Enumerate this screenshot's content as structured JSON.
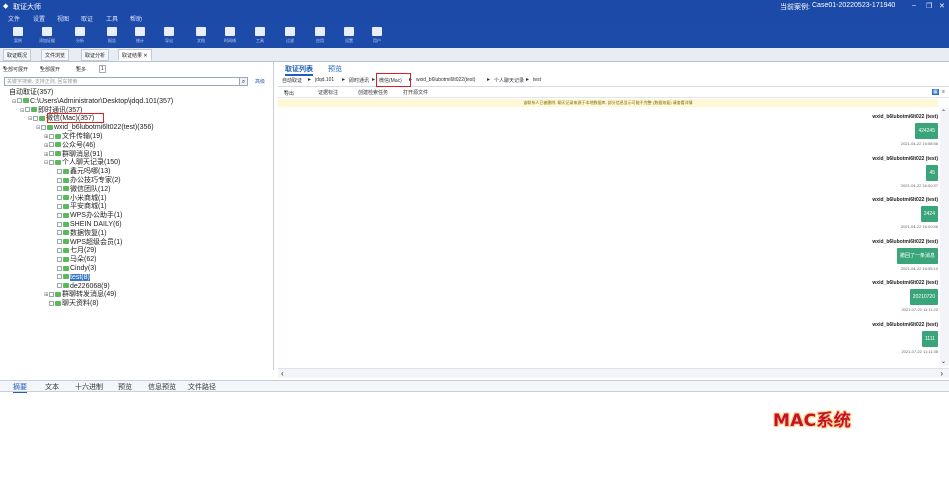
{
  "app": {
    "title": "取证大师",
    "case_label": "当前案例:",
    "case_name": "Case01-20220523-171940",
    "window_controls": [
      "–",
      "❐",
      "✕"
    ]
  },
  "menu": [
    "文件",
    "设置",
    "视图",
    "取证",
    "工具",
    "帮助"
  ],
  "toolbar": [
    {
      "icon": "case-icon",
      "label": "案例"
    },
    {
      "icon": "add-evidence-icon",
      "label": "添加证据"
    },
    {
      "icon": "analyze-icon",
      "label": "分析"
    },
    {
      "icon": "report-icon",
      "label": "报告"
    },
    {
      "icon": "stats-icon",
      "label": "统计"
    },
    {
      "icon": "export-icon",
      "label": "导出"
    },
    {
      "icon": "document-icon",
      "label": "文档"
    },
    {
      "icon": "timeline-icon",
      "label": "时间线"
    },
    {
      "icon": "tool-icon",
      "label": "工具"
    },
    {
      "icon": "filter-icon",
      "label": "过滤"
    },
    {
      "icon": "apps-icon",
      "label": "应用"
    },
    {
      "icon": "settings-icon",
      "label": "设置"
    },
    {
      "icon": "user-icon",
      "label": "用户"
    }
  ],
  "doc_tabs": [
    "取证概况",
    "文件浏览",
    "取证分析",
    "取证结果"
  ],
  "left_tools": {
    "a": "全部可展开",
    "b": "全部展开",
    "c": "更多",
    "count": "1"
  },
  "search": {
    "placeholder": "关键字搜索, 支持正则, 回车搜索",
    "advanced": "高级"
  },
  "tree": [
    {
      "text": "自动取证(357)",
      "level": 0,
      "exp": "",
      "selected": false
    },
    {
      "text": "C:\\Users\\Administrator\\Desktop\\jdqd.101(357)",
      "level": 1,
      "exp": "⊟",
      "selected": false
    },
    {
      "text": "即时通讯(357)",
      "level": 2,
      "exp": "⊟",
      "selected": false
    },
    {
      "text": "微信(Mac)(357)",
      "level": 3,
      "exp": "⊟",
      "selected": false
    },
    {
      "text": "wxid_b6lubotmi6lt022(test)(356)",
      "level": 4,
      "exp": "⊟",
      "selected": false
    },
    {
      "text": "文件传输(19)",
      "level": 5,
      "exp": "⊞",
      "selected": false
    },
    {
      "text": "公众号(46)",
      "level": 5,
      "exp": "⊞",
      "selected": false
    },
    {
      "text": "群聊消息(91)",
      "level": 5,
      "exp": "⊞",
      "selected": false
    },
    {
      "text": "个人聊天记录(150)",
      "level": 5,
      "exp": "⊟",
      "selected": false
    },
    {
      "text": "鑫元吗哪(13)",
      "level": 6,
      "exp": "",
      "selected": false
    },
    {
      "text": "办公技巧专家(2)",
      "level": 6,
      "exp": "",
      "selected": false
    },
    {
      "text": "微信团队(12)",
      "level": 6,
      "exp": "",
      "selected": false
    },
    {
      "text": "小米商城(1)",
      "level": 6,
      "exp": "",
      "selected": false
    },
    {
      "text": "平安商城(1)",
      "level": 6,
      "exp": "",
      "selected": false
    },
    {
      "text": "WPS办公助手(1)",
      "level": 6,
      "exp": "",
      "selected": false
    },
    {
      "text": "SHEIN DAILY(6)",
      "level": 6,
      "exp": "",
      "selected": false
    },
    {
      "text": "数据恢复(1)",
      "level": 6,
      "exp": "",
      "selected": false
    },
    {
      "text": "WPS超级会员(1)",
      "level": 6,
      "exp": "",
      "selected": false
    },
    {
      "text": "七月(29)",
      "level": 6,
      "exp": "",
      "selected": false
    },
    {
      "text": "马朵(62)",
      "level": 6,
      "exp": "",
      "selected": false
    },
    {
      "text": "Cindy(3)",
      "level": 6,
      "exp": "",
      "selected": false
    },
    {
      "text": "test(8)",
      "level": 6,
      "exp": "",
      "selected": true
    },
    {
      "text": "de226068(9)",
      "level": 6,
      "exp": "",
      "selected": false
    },
    {
      "text": "群聊转发消息(49)",
      "level": 5,
      "exp": "⊞",
      "selected": false
    },
    {
      "text": "聊天资料(8)",
      "level": 5,
      "exp": "",
      "selected": false
    }
  ],
  "right_tabs": [
    "取证列表",
    "预览"
  ],
  "breadcrumb": [
    "自动取证",
    "jdqd.101",
    "即时通讯",
    "微信(Mac)",
    "wxid_b6lubotmi6lt022(test)",
    "个人聊天记录",
    "test"
  ],
  "subtools": [
    "导出",
    "证据标注",
    "创建检索任务",
    "打开源文件"
  ],
  "notice": "该联系人已被删除, 聊天记录来源于本地数据库, 部分信息显示可能不完整 (数据恢复) 请查看详情",
  "messages": [
    {
      "sender": "wxid_b6lubotmi6lt022 (test)",
      "text": "424245",
      "time": "2021-04-22 15:58:56"
    },
    {
      "sender": "wxid_b6lubotmi6lt022 (test)",
      "text": "45",
      "time": "2021-04-22 16:00:37"
    },
    {
      "sender": "wxid_b6lubotmi6lt022 (test)",
      "text": "2424",
      "time": "2021-04-22 16:00:56"
    },
    {
      "sender": "wxid_b6lubotmi6lt022 (test)",
      "text": "撤回了一条消息",
      "time": "2021-04-22 16:05:10"
    },
    {
      "sender": "wxid_b6lubotmi6lt022 (test)",
      "text": "20210720",
      "time": "2021-07-22 11:11:20"
    },
    {
      "sender": "wxid_b6lubotmi6lt022 (test)",
      "text": "1111",
      "time": "2021-07-22 11:11:38"
    }
  ],
  "bottom_tabs": [
    "摘要",
    "文本",
    "十六进制",
    "预览",
    "信息预览",
    "文件路径"
  ],
  "caption": "MAC系统",
  "colors": {
    "title_bg": "#1c4aa8",
    "accent": "#1f5fb6",
    "bubble": "#3aa57a",
    "highlight": "#e02020"
  }
}
